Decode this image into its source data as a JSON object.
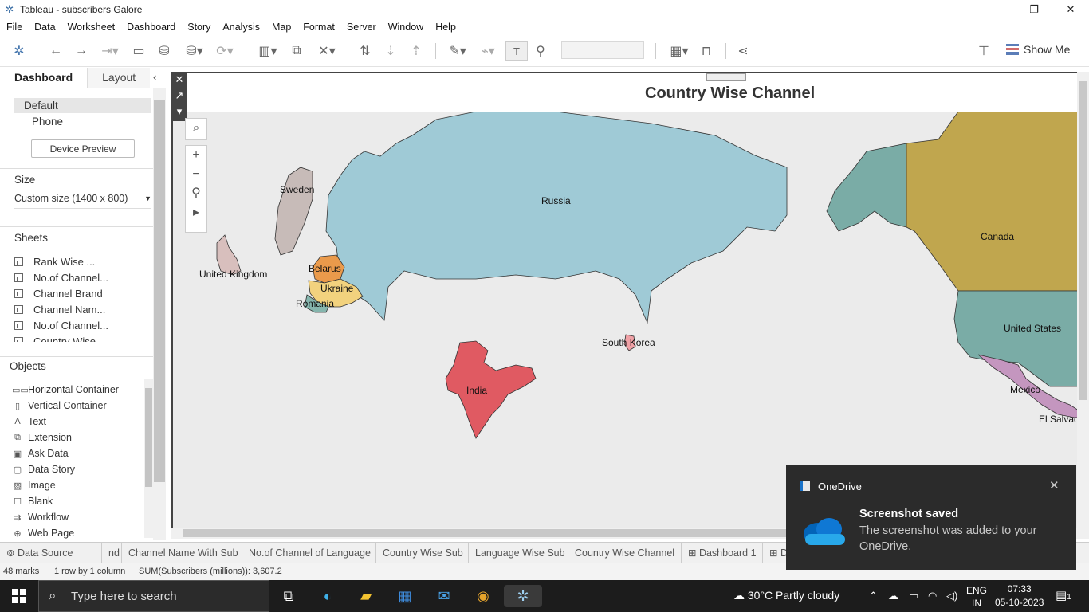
{
  "window": {
    "title": "Tableau - subscribers Galore"
  },
  "menu": [
    "File",
    "Data",
    "Worksheet",
    "Dashboard",
    "Story",
    "Analysis",
    "Map",
    "Format",
    "Server",
    "Window",
    "Help"
  ],
  "toolbar": {
    "show_me": "Show Me"
  },
  "left_pane": {
    "tabs": {
      "dashboard": "Dashboard",
      "layout": "Layout"
    },
    "devices": {
      "default": "Default",
      "phone": "Phone",
      "preview_button": "Device Preview"
    },
    "size": {
      "title": "Size",
      "value": "Custom size (1400 x 800)"
    },
    "sheets": {
      "title": "Sheets",
      "items": [
        "Rank Wise ...",
        "No.of Channel...",
        "Channel Brand",
        "Channel Nam...",
        "No.of Channel...",
        "Country Wise..."
      ]
    },
    "objects": {
      "title": "Objects",
      "items": [
        "Horizontal Container",
        "Vertical Container",
        "Text",
        "Extension",
        "Ask Data",
        "Data Story",
        "Image",
        "Blank",
        "Workflow",
        "Web Page"
      ]
    }
  },
  "dashboard": {
    "title": "Country Wise Channel",
    "countries": [
      "Sweden",
      "Russia",
      "Canada",
      "United Kingdom",
      "Belarus",
      "Ukraine",
      "Romania",
      "South Korea",
      "United States",
      "India",
      "Mexico",
      "El Salvad"
    ]
  },
  "colors": {
    "russia": "#9fcad6",
    "canada": "#c0a64e",
    "united_states": "#7aaca6",
    "alaska": "#7aaca6",
    "india": "#e05a62",
    "mexico": "#c496bf",
    "sweden": "#c7bbb8",
    "uk": "#d8bfbd",
    "belarus": "#ea9a4b",
    "ukraine": "#f2d27e",
    "romania": "#85b5ad",
    "south_korea": "#f0a1a6"
  },
  "sheet_tabs": [
    "Data Source",
    "nd",
    "Channel Name With Sub",
    "No.of Channel of Language",
    "Country Wise Sub",
    "Language Wise Sub",
    "Country Wise Channel",
    "Dashboard 1",
    "D"
  ],
  "status": {
    "marks": "48 marks",
    "rows": "1 row by 1 column",
    "sum": "SUM(Subscribers (millions)): 3,607.2"
  },
  "toast": {
    "source": "OneDrive",
    "headline": "Screenshot saved",
    "body": "The screenshot was added to your OneDrive."
  },
  "taskbar": {
    "search_placeholder": "Type here to search",
    "weather": "30°C  Partly cloudy",
    "lang_top": "ENG",
    "lang_bottom": "IN",
    "time": "07:33",
    "date": "05-10-2023",
    "notifications": "1"
  }
}
